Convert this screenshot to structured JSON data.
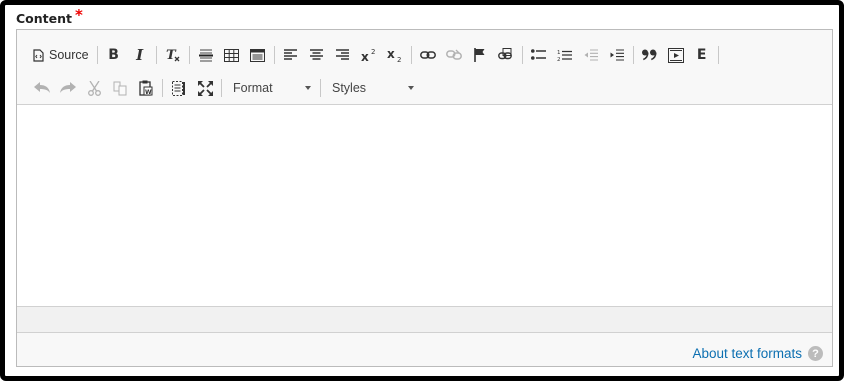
{
  "field": {
    "label": "Content",
    "required_marker": "*"
  },
  "toolbar": {
    "source_label": "Source",
    "format_label": "Format",
    "styles_label": "Styles"
  },
  "footer": {
    "about_link": "About text formats",
    "help_glyph": "?"
  },
  "colors": {
    "link": "#0c6fb1",
    "required": "#e00000",
    "toolbar_bg": "#f8f8f8"
  }
}
